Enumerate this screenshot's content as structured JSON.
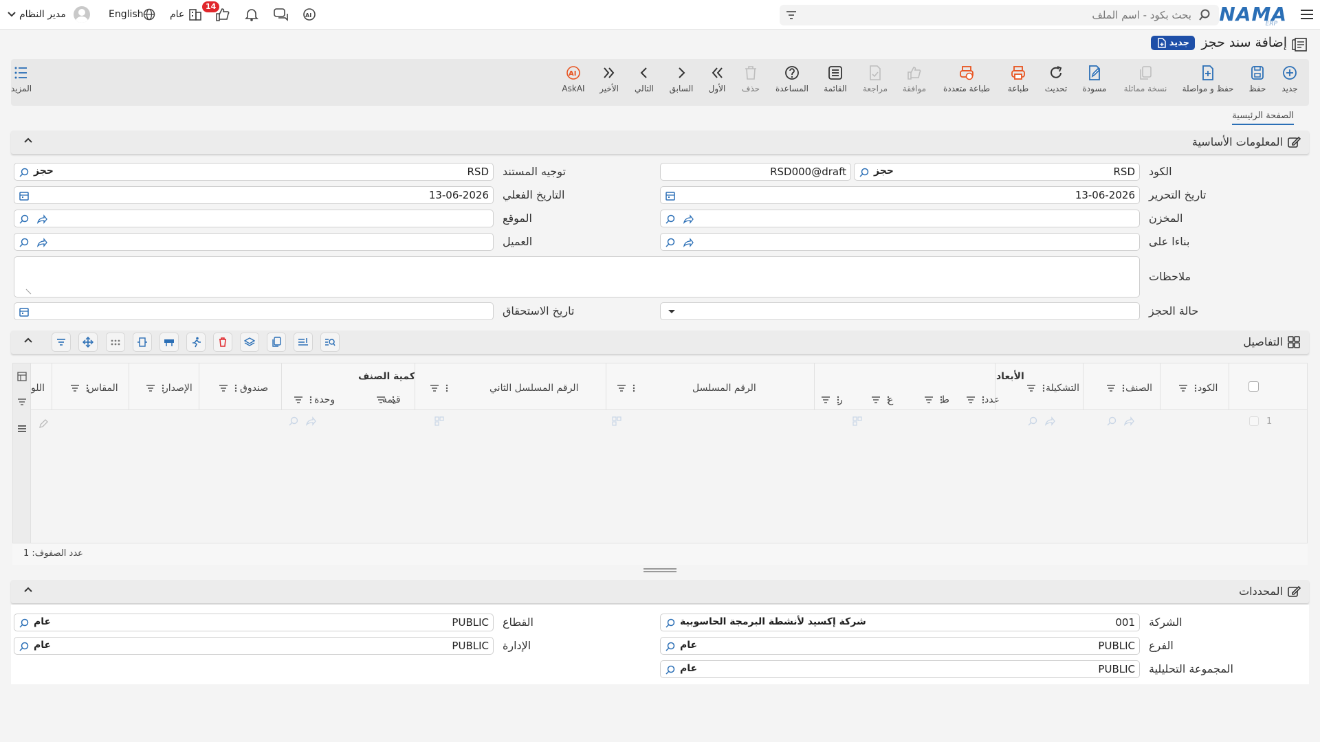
{
  "topbar": {
    "logo": "NAMA",
    "logo_sub": "ERP",
    "search_placeholder": "بحث بكود - اسم الملف",
    "user": "مدير النظام",
    "language": "English",
    "scope": "عام",
    "notif_count": "14"
  },
  "page": {
    "title": "إضافة سند حجز",
    "new_badge": "جديد"
  },
  "toolbar": [
    {
      "label": "جديد",
      "icon": "plus-circle-icon"
    },
    {
      "label": "حفظ",
      "icon": "save-icon"
    },
    {
      "label": "حفظ و مواصلة",
      "icon": "save-continue-icon"
    },
    {
      "label": "نسخة مماثلة",
      "icon": "copy-icon"
    },
    {
      "label": "مسودة",
      "icon": "draft-icon"
    },
    {
      "label": "تحديث",
      "icon": "refresh-icon"
    },
    {
      "label": "طباعة",
      "icon": "print-icon"
    },
    {
      "label": "طباعة متعددة",
      "icon": "multi-print-icon"
    },
    {
      "label": "موافقة",
      "icon": "thumbs-up-icon"
    },
    {
      "label": "مراجعة",
      "icon": "review-icon"
    },
    {
      "label": "القائمة",
      "icon": "list-icon"
    },
    {
      "label": "المساعدة",
      "icon": "help-icon"
    },
    {
      "label": "حذف",
      "icon": "trash-icon"
    },
    {
      "label": "الأول",
      "icon": "first-icon"
    },
    {
      "label": "السابق",
      "icon": "previous-icon"
    },
    {
      "label": "التالي",
      "icon": "next-icon"
    },
    {
      "label": "الأخير",
      "icon": "last-icon"
    },
    {
      "label": "AskAI",
      "icon": "ai-icon"
    },
    {
      "label": "المزيد",
      "icon": "more-icon"
    }
  ],
  "tabs": {
    "main": "الصفحة الرئيسية"
  },
  "basic": {
    "title": "المعلومات الأساسية",
    "code_label": "الكود",
    "code_value": "RSD",
    "code_tag": "حجز",
    "code_draft": "RSD000@draft",
    "doc_dir_label": "توجيه المستند",
    "doc_dir_value": "RSD",
    "doc_dir_tag": "حجز",
    "edit_date_label": "تاريخ التحرير",
    "edit_date_value": "13-06-2026",
    "actual_date_label": "التاريخ الفعلي",
    "actual_date_value": "13-06-2026",
    "warehouse_label": "المخزن",
    "location_label": "الموقع",
    "based_on_label": "بناءا على",
    "customer_label": "العميل",
    "notes_label": "ملاحظات",
    "status_label": "حالة الحجز",
    "due_date_label": "تاريخ الاستحقاق"
  },
  "details": {
    "title": "التفاصيل",
    "columns": {
      "code": "الكود",
      "item": "الصنف",
      "config": "التشكيلة",
      "dimensions": "الأبعاد",
      "count": "عدد",
      "t": "ط",
      "a": "ع",
      "r": "ر",
      "serial": "الرقم المسلسل",
      "serial2": "الرقم المسلسل الثاني",
      "qty": "كمية الصنف",
      "value": "قيمة",
      "unit": "وحدة",
      "box": "صندوق",
      "version": "الإصدار",
      "size": "المقاس",
      "more": "اللو"
    },
    "row_number": "1",
    "row_count": "عدد الصفوف: 1"
  },
  "determinants": {
    "title": "المحددات",
    "company_label": "الشركة",
    "company_value": "001",
    "company_tag": "شركة إكسيد لأنشطة البرمجة الحاسوبية",
    "sector_label": "القطاع",
    "sector_value": "PUBLIC",
    "sector_tag": "عام",
    "branch_label": "الفرع",
    "branch_value": "PUBLIC",
    "branch_tag": "عام",
    "dept_label": "الإدارة",
    "dept_value": "PUBLIC",
    "dept_tag": "عام",
    "analytic_label": "المجموعة التحليلية",
    "analytic_value": "PUBLIC",
    "analytic_tag": "عام"
  },
  "colors": {
    "brand": "#2b6fb6",
    "badge": "#1e4fa8",
    "accent_orange": "#e8531f",
    "danger": "#e0262b"
  }
}
